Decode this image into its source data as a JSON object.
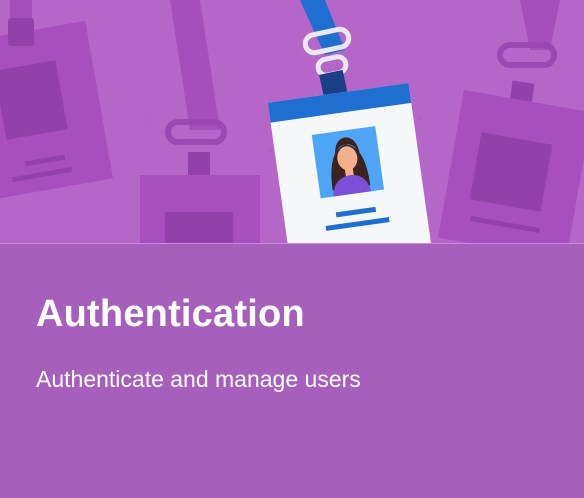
{
  "card": {
    "title": "Authentication",
    "subtitle": "Authenticate and manage users"
  },
  "illustration": {
    "icons": [
      "lanyard-badge-icon",
      "user-avatar-icon"
    ]
  },
  "colors": {
    "header_background": "#b566c9",
    "card_background": "#a65fba",
    "lanyard_blue": "#1f6fd0",
    "badge_white": "#f5f7f9",
    "text": "#ffffff"
  }
}
